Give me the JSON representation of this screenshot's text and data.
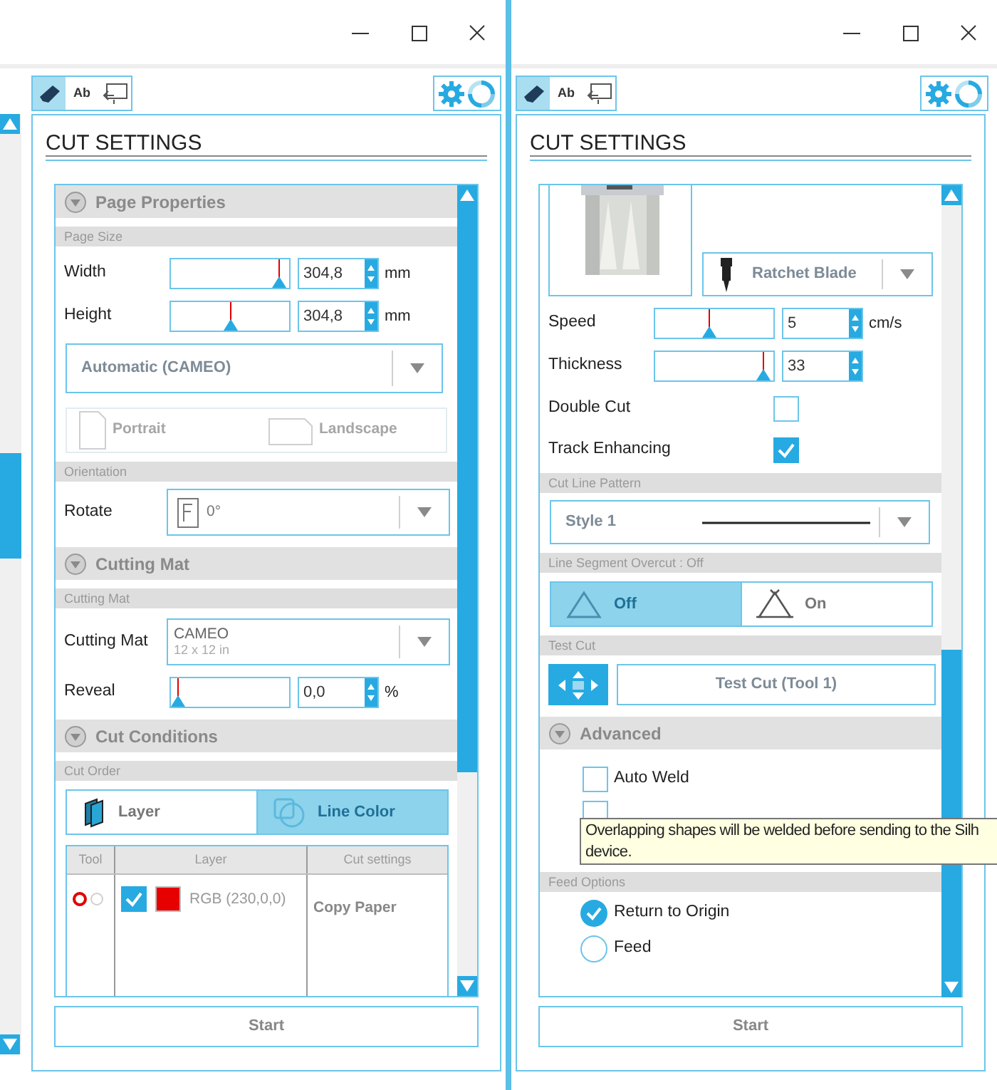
{
  "windows": [
    {
      "toolbar": {
        "tabs": [
          {
            "kind": "cut",
            "selected": true
          },
          {
            "kind": "text",
            "label": "Ab",
            "selected": false
          },
          {
            "kind": "send",
            "selected": false
          }
        ]
      },
      "panel_title": "CUT SETTINGS",
      "items": [
        {
          "kind": "header",
          "label": "Page Properties",
          "expanded": true
        },
        {
          "kind": "subheader",
          "label": "Page Size"
        },
        {
          "kind": "slider",
          "label": "Width",
          "level": 0.97,
          "value": "304,8",
          "unit": "mm"
        },
        {
          "kind": "slider",
          "label": "Height",
          "level": 0.5,
          "value": "304,8",
          "unit": "mm"
        },
        {
          "kind": "dropdown",
          "value": "Automatic (CAMEO)"
        },
        {
          "kind": "orientation",
          "disabled": true,
          "options": [
            {
              "label": "Portrait"
            },
            {
              "label": "Landscape"
            }
          ]
        },
        {
          "kind": "subheader",
          "label": "Orientation"
        },
        {
          "kind": "rotate_dropdown",
          "label": "Rotate",
          "value": "0°"
        },
        {
          "kind": "header",
          "label": "Cutting Mat",
          "expanded": true
        },
        {
          "kind": "subheader",
          "label": "Cutting Mat"
        },
        {
          "kind": "mat_dropdown",
          "label": "Cutting Mat",
          "value": "CAMEO",
          "sub": "12 x 12 in"
        },
        {
          "kind": "slider",
          "label": "Reveal",
          "level": 0.0,
          "value": "0,0",
          "unit": "%"
        },
        {
          "kind": "header",
          "label": "Cut Conditions",
          "expanded": true
        },
        {
          "kind": "subheader",
          "label": "Cut Order"
        },
        {
          "kind": "segmented",
          "options": [
            {
              "kind": "layer",
              "label": "Layer",
              "selected": false
            },
            {
              "kind": "line_color",
              "label": "Line Color",
              "selected": true
            }
          ]
        },
        {
          "kind": "table",
          "columns": [
            "Tool",
            "Layer",
            "Cut settings"
          ],
          "rows": [
            {
              "tools": [
                {
                  "selected": true
                },
                {
                  "selected": false
                }
              ],
              "checked": true,
              "color": "#e60000",
              "layer": "RGB (230,0,0)",
              "cut_settings": "Copy Paper"
            }
          ]
        }
      ],
      "start_button": "Start"
    },
    {
      "toolbar": {
        "tabs": [
          {
            "kind": "cut",
            "selected": true
          },
          {
            "kind": "text",
            "label": "Ab",
            "selected": false
          },
          {
            "kind": "send",
            "selected": false
          }
        ]
      },
      "panel_title": "CUT SETTINGS",
      "items": [
        {
          "kind": "tool_select",
          "value": "Ratchet Blade"
        },
        {
          "kind": "slider",
          "label": "Speed",
          "level": 0.45,
          "value": "5",
          "unit": "cm/s"
        },
        {
          "kind": "slider",
          "label": "Thickness",
          "level": 0.97,
          "value": "33"
        },
        {
          "kind": "checkbox_row",
          "label": "Double Cut",
          "checked": false
        },
        {
          "kind": "checkbox_row",
          "label": "Track Enhancing",
          "checked": true
        },
        {
          "kind": "subheader",
          "label": "Cut Line Pattern"
        },
        {
          "kind": "pattern_dropdown",
          "value": "Style 1"
        },
        {
          "kind": "subheader",
          "label": "Line Segment Overcut : Off"
        },
        {
          "kind": "segmented",
          "options": [
            {
              "kind": "overcut_off",
              "label": "Off",
              "selected": true
            },
            {
              "kind": "overcut_on",
              "label": "On",
              "selected": false
            }
          ]
        },
        {
          "kind": "subheader",
          "label": "Test Cut"
        },
        {
          "kind": "test_cut",
          "label": "Test Cut (Tool 1)"
        },
        {
          "kind": "header",
          "label": "Advanced",
          "expanded": true
        },
        {
          "kind": "checkbox",
          "label": "Auto Weld",
          "checked": false
        },
        {
          "kind": "checkbox",
          "checked": false
        },
        {
          "kind": "subheader",
          "label": "Feed Options"
        },
        {
          "kind": "radio",
          "label": "Return to Origin",
          "selected": true
        },
        {
          "kind": "radio",
          "label": "Feed",
          "selected": false
        }
      ],
      "tooltip": {
        "lines": [
          "Overlapping shapes will be welded before sending to the Silh",
          "device."
        ]
      },
      "start_button": "Start"
    }
  ]
}
